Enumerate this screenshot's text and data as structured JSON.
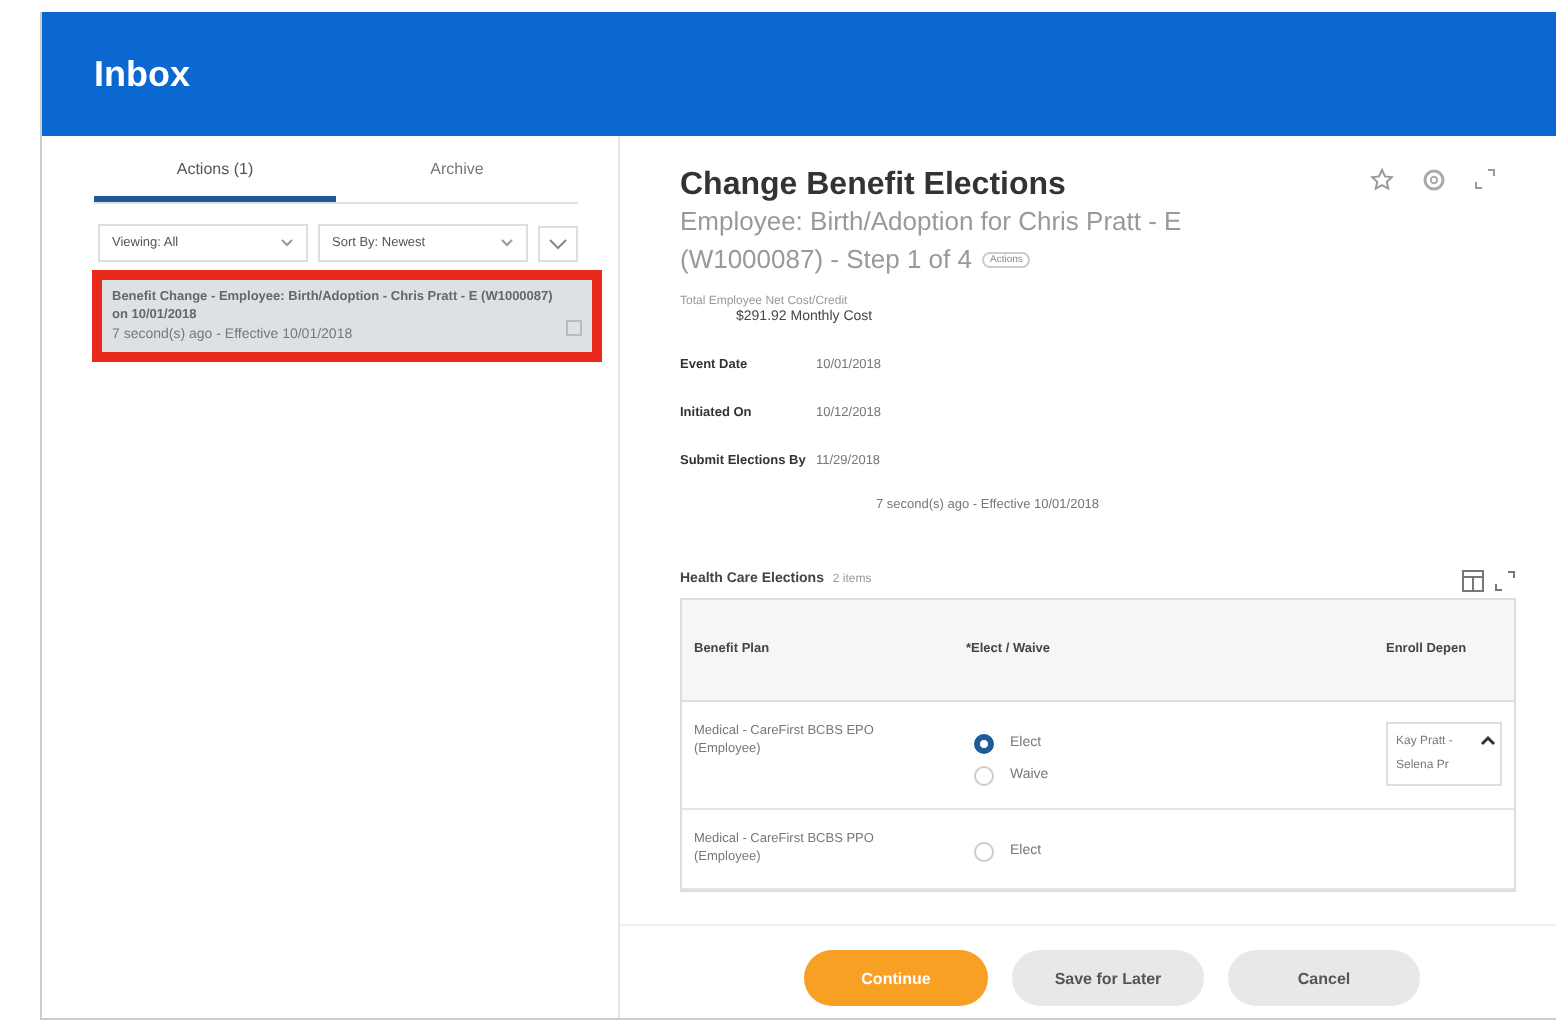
{
  "header": {
    "title": "Inbox"
  },
  "sidebar": {
    "tabs": [
      {
        "label": "Actions (1)",
        "selected": true
      },
      {
        "label": "Archive",
        "selected": false
      }
    ],
    "filters": [
      "Viewing: All",
      "Sort By: Newest"
    ],
    "items": [
      {
        "title": "Benefit Change - Employee: Birth/Adoption - Chris Pratt - E (W1000087) on 10/01/2018",
        "meta": "7 second(s) ago - Effective 10/01/2018",
        "selected": true,
        "highlighted": true
      }
    ]
  },
  "detail": {
    "title": "Change Benefit Elections",
    "subtitle_lines": [
      "Employee: Birth/Adoption for Chris Pratt - E",
      "(W1000087) - Step 1 of 4"
    ],
    "badge": "Actions",
    "total_label": "Total Employee Net Cost/Credit",
    "total_value": "$291.92 Monthly Cost",
    "fields": [
      {
        "label": "Event Date",
        "value": "10/01/2018"
      },
      {
        "label": "Initiated On",
        "value": "10/12/2018"
      },
      {
        "label": "Submit Elections By",
        "value": "11/29/2018"
      }
    ],
    "status": "7 second(s) ago - Effective 10/01/2018",
    "section": {
      "title": "Health Care Elections",
      "count": "2 items",
      "columns": [
        "Benefit Plan",
        "*Elect / Waive",
        "Enroll Depen"
      ],
      "rows": [
        {
          "plan": "Medical - CareFirst BCBS EPO (Employee)",
          "options": [
            {
              "label": "Elect",
              "selected": true
            },
            {
              "label": "Waive",
              "selected": false
            }
          ],
          "dependents": [
            "Kay Pratt -",
            "Selena Pr"
          ]
        },
        {
          "plan": "Medical - CareFirst BCBS PPO (Employee)",
          "options": [
            {
              "label": "Elect",
              "selected": false
            }
          ],
          "dependents": []
        }
      ]
    }
  },
  "buttons": [
    {
      "label": "Continue",
      "kind": "primary"
    },
    {
      "label": "Save for Later",
      "kind": "secondary"
    },
    {
      "label": "Cancel",
      "kind": "secondary"
    }
  ]
}
